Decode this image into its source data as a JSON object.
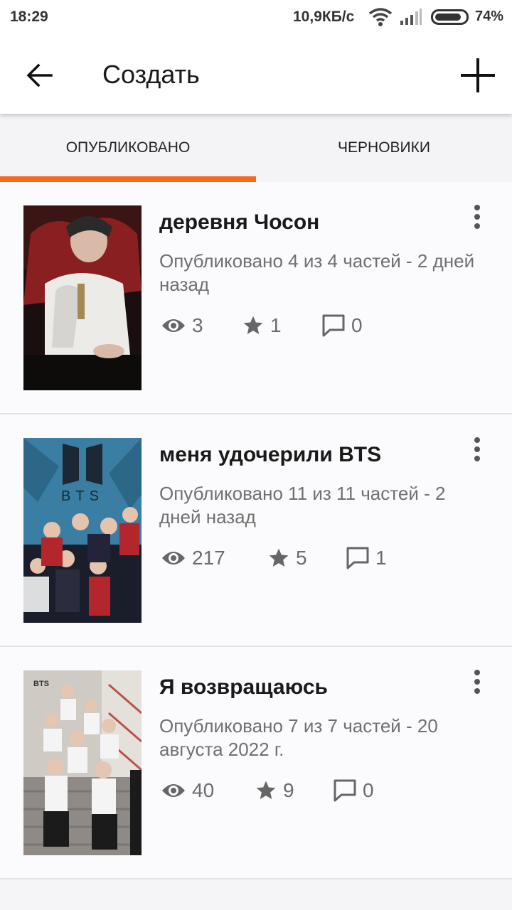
{
  "status_bar": {
    "time": "18:29",
    "speed": "10,9КБ/с",
    "battery": "74%"
  },
  "app_bar": {
    "title": "Создать"
  },
  "tabs": [
    {
      "label": "ОПУБЛИКОВАНО",
      "active": true
    },
    {
      "label": "ЧЕРНОВИКИ",
      "active": false
    }
  ],
  "accent_color": "#f36b21",
  "stories": [
    {
      "title": "деревня Чосон",
      "meta": "Опубликовано 4 из 4 частей - 2 дней назад",
      "views": "3",
      "votes": "1",
      "comments": "0"
    },
    {
      "title": "меня удочерили BTS",
      "meta": "Опубликовано 11 из 11 частей - 2 дней назад",
      "views": "217",
      "votes": "5",
      "comments": "1",
      "cover_text": "BTS"
    },
    {
      "title": "Я возвращаюсь",
      "meta": "Опубликовано 7 из 7 частей - 20 августа 2022 г.",
      "views": "40",
      "votes": "9",
      "comments": "0",
      "cover_text": "BTS"
    }
  ]
}
